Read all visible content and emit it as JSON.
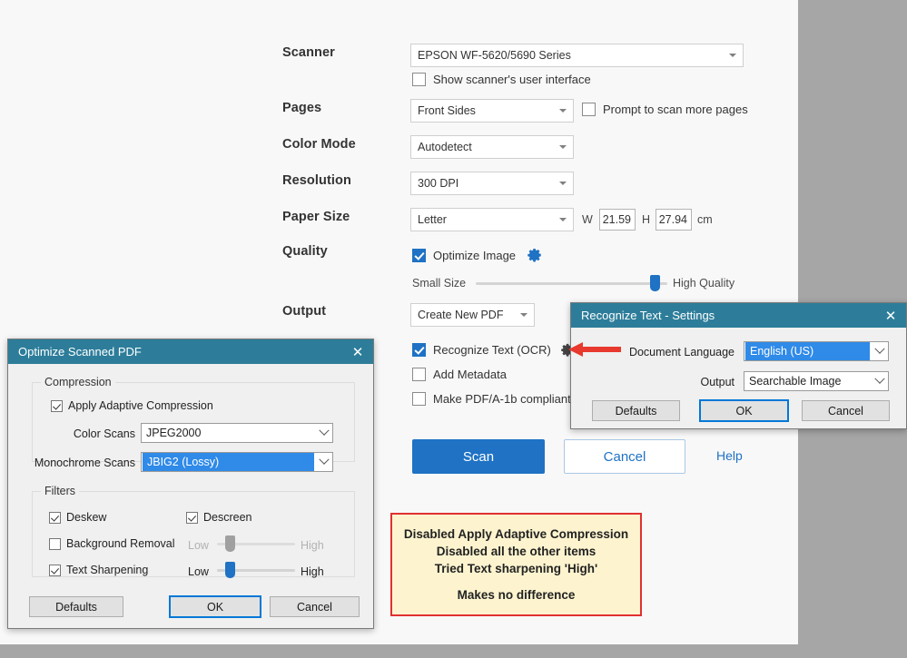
{
  "scan_window": {
    "rows": {
      "scanner": {
        "label": "Scanner",
        "value": "EPSON WF-5620/5690 Series",
        "show_ui_label": "Show scanner's user interface"
      },
      "pages": {
        "label": "Pages",
        "value": "Front Sides",
        "prompt_label": "Prompt to scan more pages"
      },
      "color_mode": {
        "label": "Color Mode",
        "value": "Autodetect"
      },
      "resolution": {
        "label": "Resolution",
        "value": "300 DPI"
      },
      "paper_size": {
        "label": "Paper Size",
        "value": "Letter",
        "w_label": "W",
        "w_value": "21.59",
        "h_label": "H",
        "h_value": "27.94",
        "unit": "cm"
      },
      "quality": {
        "label": "Quality",
        "optimize_label": "Optimize Image",
        "gear_icon": "gear-icon",
        "slider_min_label": "Small Size",
        "slider_max_label": "High Quality",
        "slider_percent": 96
      },
      "output": {
        "label": "Output",
        "value": "Create New PDF",
        "options": [
          {
            "label": "Recognize Text (OCR)",
            "checked": true,
            "gear_icon": "gear-icon"
          },
          {
            "label": "Add Metadata",
            "checked": false
          },
          {
            "label": "Make PDF/A-1b compliant",
            "checked": false
          }
        ]
      }
    },
    "buttons": {
      "scan": "Scan",
      "cancel": "Cancel",
      "help": "Help"
    }
  },
  "optimize_dialog": {
    "title": "Optimize Scanned PDF",
    "close_icon": "close-icon",
    "compression": {
      "group_title": "Compression",
      "apply_label": "Apply Adaptive Compression",
      "apply_checked": true,
      "color_scans_label": "Color Scans",
      "color_scans_value": "JPEG2000",
      "mono_scans_label": "Monochrome Scans",
      "mono_scans_value": "JBIG2 (Lossy)"
    },
    "filters": {
      "group_title": "Filters",
      "deskew_label": "Deskew",
      "deskew_checked": true,
      "descreen_label": "Descreen",
      "descreen_checked": true,
      "background_removal_label": "Background Removal",
      "background_removal_checked": false,
      "background_low": "Low",
      "background_high": "High",
      "background_percent": 12,
      "text_sharpening_label": "Text Sharpening",
      "text_sharpening_checked": true,
      "text_low": "Low",
      "text_high": "High",
      "text_percent": 12
    },
    "buttons": {
      "defaults": "Defaults",
      "ok": "OK",
      "cancel": "Cancel"
    }
  },
  "recognize_dialog": {
    "title": "Recognize Text - Settings",
    "close_icon": "close-icon",
    "document_language_label": "Document Language",
    "document_language_value": "English (US)",
    "output_label": "Output",
    "output_value": "Searchable Image",
    "buttons": {
      "defaults": "Defaults",
      "ok": "OK",
      "cancel": "Cancel"
    }
  },
  "annotation": {
    "line1": "Disabled Apply Adaptive Compression",
    "line2": "Disabled all the other items",
    "line3": "Tried Text sharpening 'High'",
    "line4": "Makes no difference",
    "border_color": "#e03030",
    "background_color": "#fdf4cf"
  },
  "colors": {
    "accent_blue": "#1f72c4",
    "dialog_teal": "#2d7d9a",
    "selection_blue": "#2f8ae8",
    "backdrop_gray": "#a6a6a6"
  }
}
